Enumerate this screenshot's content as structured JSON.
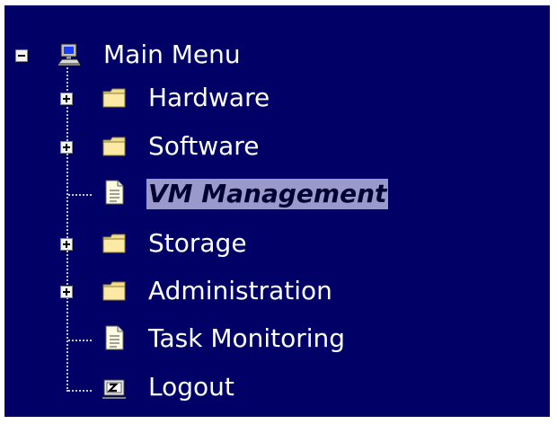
{
  "menu": {
    "root_label": "Main Menu",
    "items": [
      {
        "label": "Hardware"
      },
      {
        "label": "Software"
      },
      {
        "label": "VM Management"
      },
      {
        "label": "Storage"
      },
      {
        "label": "Administration"
      },
      {
        "label": "Task Monitoring"
      },
      {
        "label": "Logout"
      }
    ]
  },
  "icons": {
    "root": "computer-icon",
    "folder": "folder-icon",
    "document": "document-icon",
    "logout": "logout-icon"
  },
  "colors": {
    "background": "#000066",
    "text": "#ffffff",
    "selection": "#9999cc"
  }
}
